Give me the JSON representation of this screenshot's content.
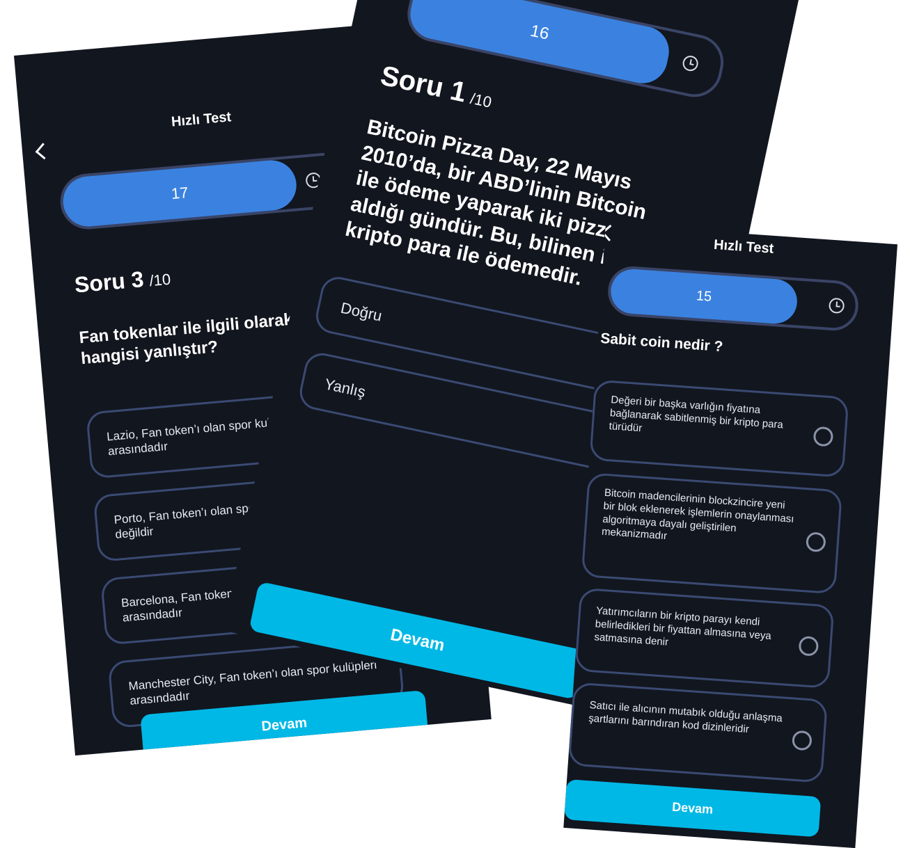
{
  "screens": {
    "left": {
      "header_title": "Hızlı Test",
      "timer_value": "17",
      "timer_progress": 0.87,
      "question_label": "Soru 3",
      "question_total": "/10",
      "question_text": "Fan tokenlar ile ilgili olarak hangisi yanlıştır?",
      "options": [
        "Lazio, Fan token’ı olan spor kulüpleri arasındadır",
        "Porto, Fan token’ı olan spor kulüpleri arasında değildir",
        "Barcelona, Fan token’ı olan spor kulüpleri arasındadır",
        "Manchester City, Fan token’ı olan spor kulüpleri arasındadır"
      ],
      "continue_label": "Devam"
    },
    "middle": {
      "timer_value": "16",
      "timer_progress": 0.82,
      "question_label": "Soru 1",
      "question_total": "/10",
      "question_text": "Bitcoin Pizza Day, 22 Mayıs 2010’da, bir ABD’linin Bitcoin ile ödeme yaparak iki pizza aldığı gündür. Bu, bilinen ilk kripto para ile ödemedir.",
      "options": [
        "Doğru",
        "Yanlış"
      ],
      "continue_label": "Devam"
    },
    "right": {
      "header_title": "Hızlı Test",
      "timer_value": "15",
      "timer_progress": 0.77,
      "question_text": "Sabit coin nedir ?",
      "options": [
        "Değeri bir başka varlığın fiyatına bağlanarak sabitlenmiş bir kripto para türüdür",
        "Bitcoin madencilerinin blockzincire yeni bir blok eklenerek işlemlerin onaylanması algoritmaya dayalı geliştirilen mekanizmadır",
        "Yatırımcıların bir kripto parayı kendi belirledikleri bir fiyattan almasına veya satmasına denir",
        "Satıcı ile alıcının mutabık olduğu anlaşma şartlarını barındıran kod dizinleridir"
      ],
      "continue_label": "Devam"
    }
  }
}
